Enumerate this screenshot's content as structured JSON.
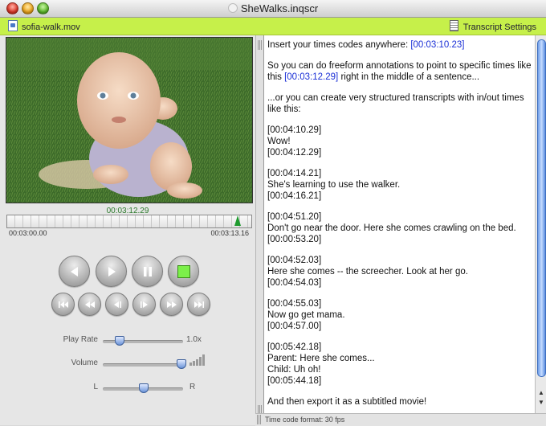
{
  "window": {
    "title": "SheWalks.inqscr"
  },
  "toolbar": {
    "file_name": "sofia-walk.mov",
    "settings_label": "Transcript Settings"
  },
  "player": {
    "current_time": "00:03:12.29",
    "start_time": "00:03:00.00",
    "end_time": "00:03:13.16",
    "playhead_fraction": 0.95
  },
  "controls": {
    "play_rate_label": "Play Rate",
    "play_rate_value": "1.0x",
    "volume_label": "Volume",
    "balance_left": "L",
    "balance_right": "R",
    "play_rate_fraction": 0.2,
    "volume_fraction": 0.97,
    "balance_fraction": 0.5
  },
  "transcript": {
    "line1_text": "Insert your times codes anywhere: ",
    "line1_tc": "[00:03:10.23]",
    "line2a": "So you can do freeform annotations to point to specific times like",
    "line2b_pre": "this ",
    "line2b_tc": "[00:03:12.29]",
    "line2b_post": " right in the middle of a sentence...",
    "line3a": "...or you can create very structured transcripts with in/out times",
    "line3b": "like this:",
    "entries": [
      {
        "in": "[00:04:10.29]",
        "lines": [
          "Wow!"
        ],
        "out": "[00:04:12.29]"
      },
      {
        "in": "[00:04:14.21]",
        "lines": [
          "She's learning to use the walker."
        ],
        "out": "[00:04:16.21]"
      },
      {
        "in": "[00:04:51.20]",
        "lines": [
          "Don't go near the door.  Here she comes crawling on the bed."
        ],
        "out": "[00:00:53.20]"
      },
      {
        "in": "[00:04:52.03]",
        "lines": [
          "Here she comes -- the screecher.  Look at her go."
        ],
        "out": "[00:04:54.03]"
      },
      {
        "in": "[00:04:55.03]",
        "lines": [
          "Now go get mama."
        ],
        "out": "[00:04:57.00]"
      },
      {
        "in": "[00:05:42.18]",
        "lines": [
          "Parent: Here she comes...",
          "Child: Uh oh!"
        ],
        "out": "[00:05:44.18]"
      }
    ],
    "closing": "And then export it as a subtitled movie!"
  },
  "status": {
    "text": "Time code format: 30 fps"
  },
  "colors": {
    "toolbar": "#c6f04a",
    "timecode": "#1a2fd6",
    "stop_button": "#7cf04a",
    "playhead": "#1e9a2e"
  },
  "icons": {
    "transport": [
      "rewind-icon",
      "play-icon",
      "pause-icon",
      "stop-icon"
    ],
    "navigation": [
      "go-to-start-icon",
      "fast-rewind-icon",
      "step-back-icon",
      "step-forward-icon",
      "fast-forward-icon",
      "go-to-end-icon"
    ]
  }
}
